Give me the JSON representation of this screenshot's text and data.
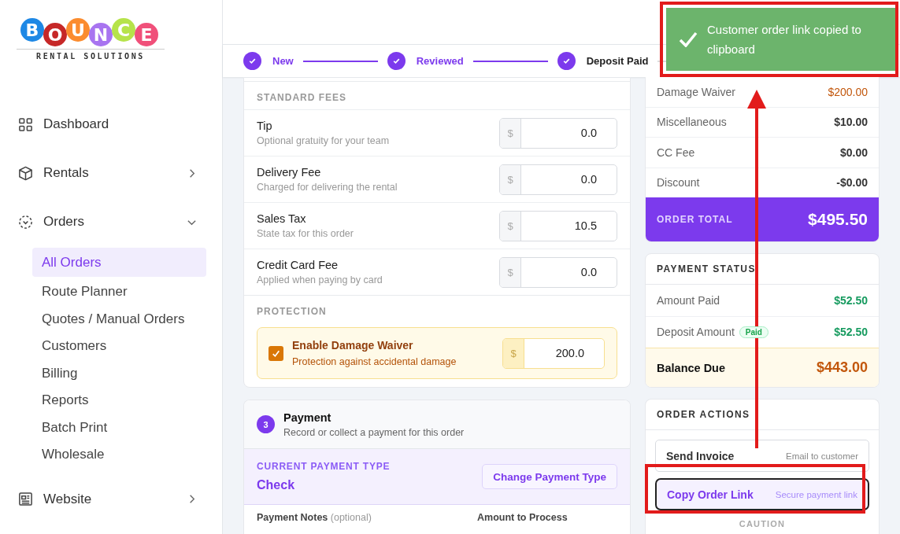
{
  "logo": {
    "letters": [
      {
        "char": "B",
        "color": "#1e88e5"
      },
      {
        "char": "O",
        "color": "#c62828"
      },
      {
        "char": "U",
        "color": "#fb8c2f"
      },
      {
        "char": "N",
        "color": "#a874f0"
      },
      {
        "char": "C",
        "color": "#b6e34a"
      },
      {
        "char": "E",
        "color": "#f0507a"
      }
    ],
    "tagline": "RENTAL SOLUTIONS"
  },
  "sidebar": {
    "items": [
      {
        "label": "Dashboard"
      },
      {
        "label": "Rentals",
        "expanded": false
      },
      {
        "label": "Orders",
        "expanded": true,
        "children": [
          {
            "label": "All Orders",
            "selected": true
          },
          {
            "label": "Route Planner",
            "selected": false
          },
          {
            "label": "Quotes / Manual Orders",
            "selected": false
          },
          {
            "label": "Customers",
            "selected": false
          },
          {
            "label": "Billing",
            "selected": false
          },
          {
            "label": "Reports",
            "selected": false
          },
          {
            "label": "Batch Print",
            "selected": false
          },
          {
            "label": "Wholesale",
            "selected": false
          }
        ]
      },
      {
        "label": "Website",
        "expanded": false
      }
    ]
  },
  "toast": {
    "message": "Customer order link copied to clipboard"
  },
  "steps": [
    {
      "label": "New",
      "done": true
    },
    {
      "label": "Reviewed",
      "done": true
    },
    {
      "label": "Deposit Paid",
      "done": true
    }
  ],
  "fees": {
    "title": "STANDARD FEES",
    "rows": [
      {
        "label": "Tip",
        "hint": "Optional gratuity for your team",
        "prefix": "$",
        "value": "0.0"
      },
      {
        "label": "Delivery Fee",
        "hint": "Charged for delivering the rental",
        "prefix": "$",
        "value": "0.0"
      },
      {
        "label": "Sales Tax",
        "hint": "State tax for this order",
        "prefix": "$",
        "value": "10.5"
      },
      {
        "label": "Credit Card Fee",
        "hint": "Applied when paying by card",
        "prefix": "$",
        "value": "0.0"
      }
    ]
  },
  "protection": {
    "title": "PROTECTION",
    "label": "Enable Damage Waiver",
    "hint": "Protection against accidental damage",
    "checked": true,
    "prefix": "$",
    "value": "200.0"
  },
  "payment": {
    "step": "3",
    "title": "Payment",
    "subtitle": "Record or collect a payment for this order",
    "type_label": "CURRENT PAYMENT TYPE",
    "type": "Check",
    "change_button": "Change Payment Type",
    "notes_label": "Payment Notes",
    "notes_hint": "(optional)",
    "amount_label": "Amount to Process"
  },
  "summary": {
    "rows": [
      {
        "label": "Damage Waiver",
        "value": "$200.00",
        "kind": "warning"
      },
      {
        "label": "Miscellaneous",
        "value": "$10.00",
        "kind": "plain"
      },
      {
        "label": "CC Fee",
        "value": "$0.00",
        "kind": "plain"
      },
      {
        "label": "Discount",
        "value": "-$0.00",
        "kind": "plain"
      }
    ],
    "total_label": "ORDER TOTAL",
    "total": "$495.50"
  },
  "payment_status": {
    "title": "PAYMENT STATUS",
    "rows": [
      {
        "label": "Amount Paid",
        "value": "$52.50"
      },
      {
        "label": "Deposit Amount",
        "badge": "Paid",
        "value": "$52.50"
      }
    ],
    "balance_label": "Balance Due",
    "balance": "$443.00"
  },
  "order_actions": {
    "title": "ORDER ACTIONS",
    "actions": [
      {
        "label": "Send Invoice",
        "hint": "Email to customer",
        "selected": false
      },
      {
        "label": "Copy Order Link",
        "hint": "Secure payment link",
        "selected": true
      }
    ],
    "caution": "CAUTION"
  }
}
